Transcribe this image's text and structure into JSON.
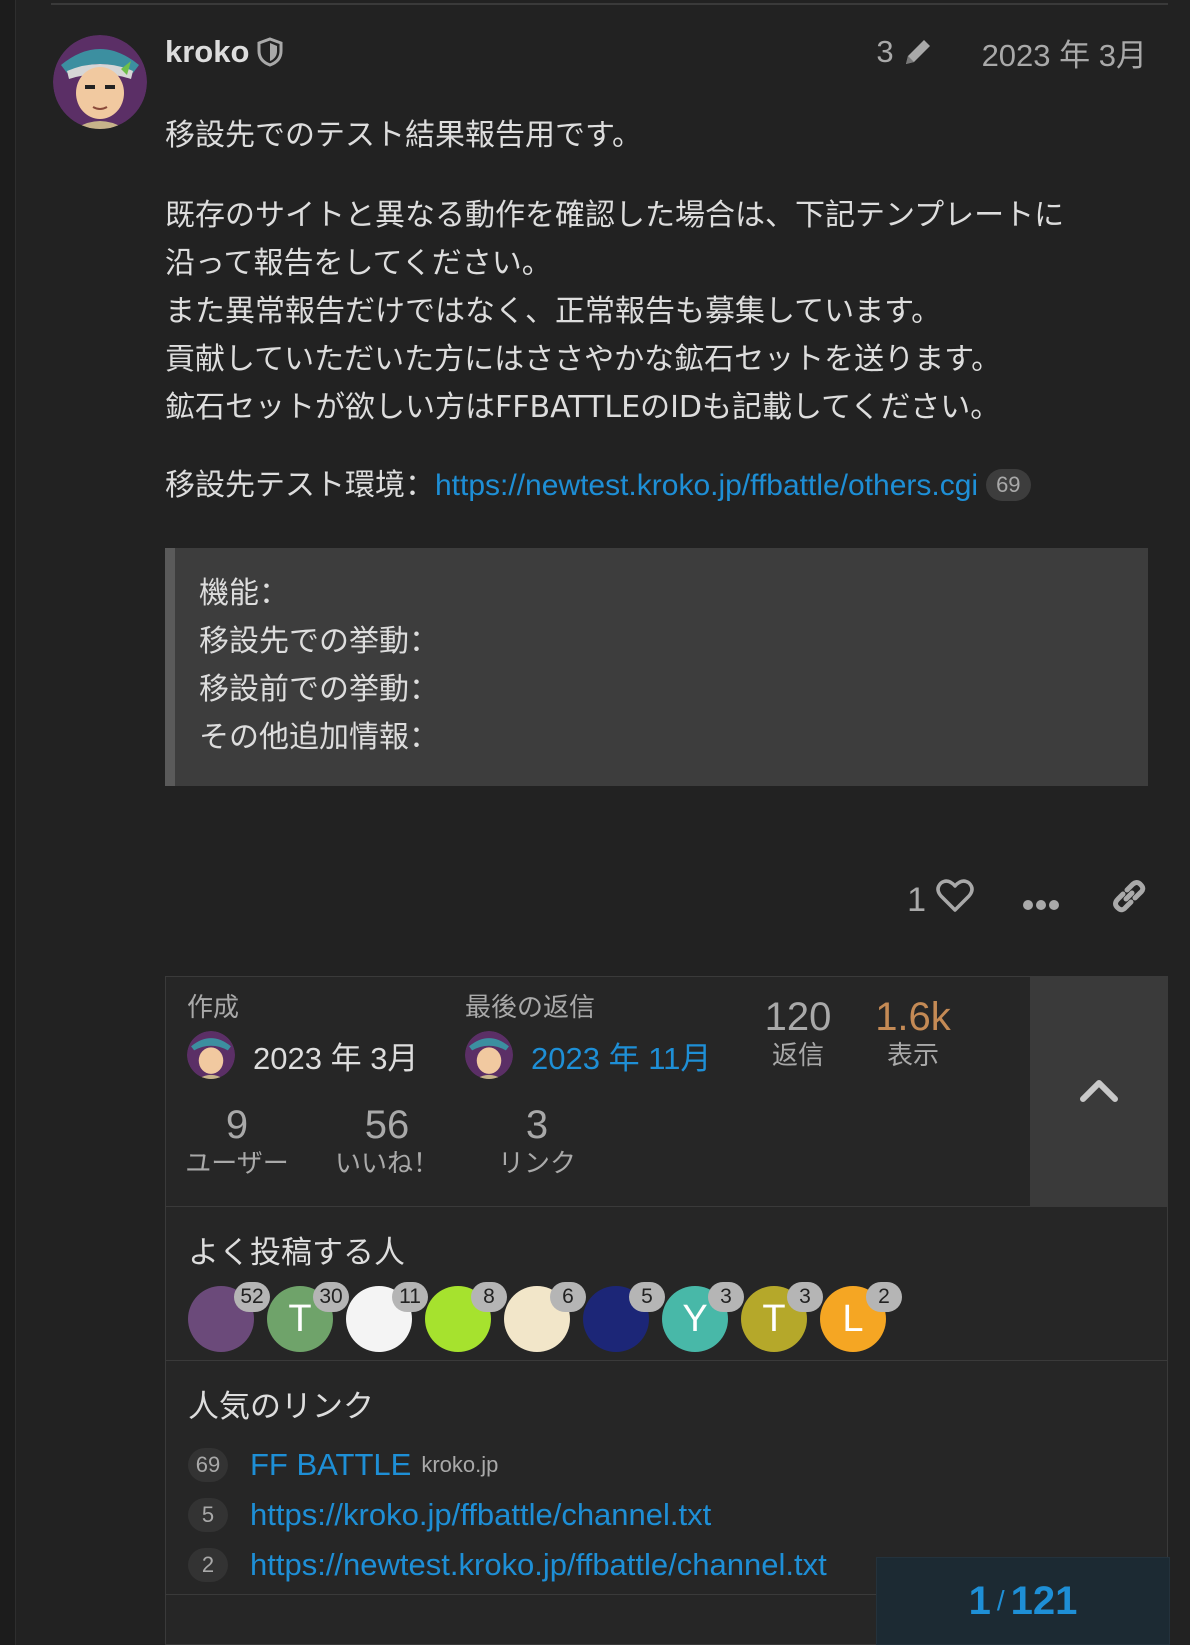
{
  "post": {
    "author": "kroko",
    "edit_count": "3",
    "date": "2023 年 3月",
    "body_intro": "移設先でのテスト結果報告用です。",
    "body_lines": [
      "既存のサイトと異なる動作を確認した場合は、下記テンプレートに",
      "沿って報告をしてください。",
      "また異常報告だけではなく、正常報告も募集しています。",
      "貢献していただいた方にはささやかな鉱石セットを送ります。",
      "鉱石セットが欲しい方はFFBATTLEのIDも記載してください。"
    ],
    "env_label": "移設先テスト環境：",
    "env_link": "https://newtest.kroko.jp/ffbattle/others.cgi",
    "env_link_clicks": "69",
    "quote_lines": [
      "機能：",
      "移設先での挙動：",
      "移設前での挙動：",
      "その他追加情報："
    ],
    "like_count": "1"
  },
  "topic_map": {
    "created_label": "作成",
    "created_date": "2023 年 3月",
    "last_reply_label": "最後の返信",
    "last_reply_date": "2023 年 11月",
    "replies": {
      "num": "120",
      "label": "返信"
    },
    "views": {
      "num": "1.6k",
      "label": "表示"
    },
    "users": {
      "num": "9",
      "label": "ユーザー"
    },
    "likes": {
      "num": "56",
      "label": "いいね！"
    },
    "links": {
      "num": "3",
      "label": "リンク"
    },
    "frequent_posters_title": "よく投稿する人",
    "frequent_posters": [
      {
        "letter": "",
        "count": "52",
        "color": "#6b4a7a",
        "kind": "image-kroko"
      },
      {
        "letter": "T",
        "count": "30",
        "color": "#6fa36a",
        "kind": "letter"
      },
      {
        "letter": "",
        "count": "11",
        "color": "#f4f4f4",
        "kind": "image-white"
      },
      {
        "letter": "",
        "count": "8",
        "color": "#a6e22e",
        "kind": "image-green"
      },
      {
        "letter": "",
        "count": "6",
        "color": "#f2e6c9",
        "kind": "image-cream"
      },
      {
        "letter": "",
        "count": "5",
        "color": "#1c2677",
        "kind": "image-surge"
      },
      {
        "letter": "Y",
        "count": "3",
        "color": "#48b8a8",
        "kind": "letter"
      },
      {
        "letter": "T",
        "count": "3",
        "color": "#b5a82a",
        "kind": "letter"
      },
      {
        "letter": "L",
        "count": "2",
        "color": "#f5a623",
        "kind": "letter"
      }
    ],
    "popular_links_title": "人気のリンク",
    "popular_links": [
      {
        "count": "69",
        "text": "FF BATTLE",
        "domain": "kroko.jp"
      },
      {
        "count": "5",
        "text": "https://kroko.jp/ffbattle/channel.txt",
        "domain": ""
      },
      {
        "count": "2",
        "text": "https://newtest.kroko.jp/ffbattle/channel.txt",
        "domain": ""
      }
    ]
  },
  "progress": {
    "current": "1",
    "separator": "/",
    "total": "121"
  },
  "colors": {
    "link": "#1e8fd6",
    "views": "#c48a55",
    "background": "#222222"
  }
}
